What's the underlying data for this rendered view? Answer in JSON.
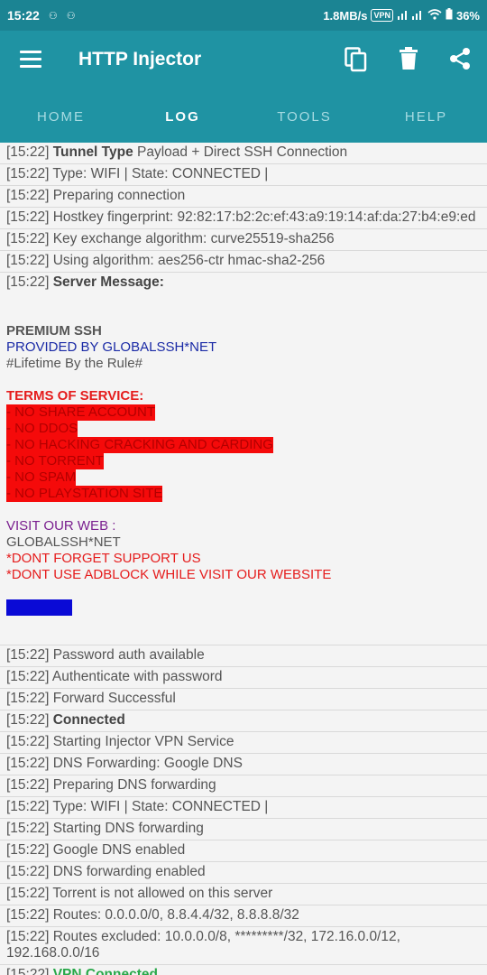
{
  "status_bar": {
    "time": "15:22",
    "speed": "1.8MB/s",
    "vpn_badge": "VPN",
    "battery": "36%"
  },
  "app_bar": {
    "title": "HTTP Injector",
    "icons": [
      "menu-icon",
      "copy-icon",
      "delete-icon",
      "share-icon"
    ]
  },
  "tabs": [
    {
      "label": "HOME",
      "active": false
    },
    {
      "label": "LOG",
      "active": true
    },
    {
      "label": "TOOLS",
      "active": false
    },
    {
      "label": "HELP",
      "active": false
    }
  ],
  "log_top": [
    {
      "ts": "[15:22]",
      "bold": "Tunnel Type",
      "text": " Payload + Direct SSH Connection"
    },
    {
      "ts": "[15:22]",
      "bold": "",
      "text": " Type: WIFI | State: CONNECTED |"
    },
    {
      "ts": "[15:22]",
      "bold": "",
      "text": " Preparing connection"
    },
    {
      "ts": "[15:22]",
      "bold": "",
      "text": " Hostkey fingerprint: 92:82:17:b2:2c:ef:43:a9:19:14:af:da:27:b4:e9:ed"
    },
    {
      "ts": "[15:22]",
      "bold": "",
      "text": " Key exchange algorithm: curve25519-sha256"
    },
    {
      "ts": "[15:22]",
      "bold": "",
      "text": " Using algorithm: aes256-ctr hmac-sha2-256"
    }
  ],
  "server_message": {
    "ts": "[15:22]",
    "label": "Server Message:",
    "title": "PREMIUM SSH",
    "provided": "PROVIDED BY GLOBALSSH*NET",
    "tagline": "#Lifetime By the Rule#",
    "tos_title": "TERMS OF SERVICE:",
    "tos_items": [
      "- NO SHARE ACCOUNT",
      "- NO DDOS",
      "- NO HACKING CRACKING AND CARDING",
      "- NO TORRENT",
      "- NO SPAM",
      "- NO PLAYSTATION SITE"
    ],
    "visit": "VISIT OUR WEB :",
    "site": "GLOBALSSH*NET",
    "support": "*DONT FORGET SUPPORT US",
    "adblock": "*DONT USE ADBLOCK WHILE VISIT OUR WEBSITE"
  },
  "log_bottom": [
    {
      "ts": "[15:22]",
      "text": " Password auth available",
      "style": ""
    },
    {
      "ts": "[15:22]",
      "text": " Authenticate with password",
      "style": ""
    },
    {
      "ts": "[15:22]",
      "text": " Forward Successful",
      "style": ""
    },
    {
      "ts": "[15:22]",
      "text": " Connected",
      "style": "bold"
    },
    {
      "ts": "[15:22]",
      "text": " Starting Injector VPN Service",
      "style": ""
    },
    {
      "ts": "[15:22]",
      "text": " DNS Forwarding: Google DNS",
      "style": ""
    },
    {
      "ts": "[15:22]",
      "text": " Preparing DNS forwarding",
      "style": ""
    },
    {
      "ts": "[15:22]",
      "text": " Type: WIFI | State: CONNECTED |",
      "style": ""
    },
    {
      "ts": "[15:22]",
      "text": " Starting DNS forwarding",
      "style": ""
    },
    {
      "ts": "[15:22]",
      "text": " Google DNS enabled",
      "style": ""
    },
    {
      "ts": "[15:22]",
      "text": " DNS forwarding enabled",
      "style": ""
    },
    {
      "ts": "[15:22]",
      "text": " Torrent is not allowed on this server",
      "style": ""
    },
    {
      "ts": "[15:22]",
      "text": " Routes: 0.0.0.0/0, 8.8.4.4/32, 8.8.8.8/32",
      "style": ""
    },
    {
      "ts": "[15:22]",
      "text": " Routes excluded: 10.0.0.0/8, *********/32, 172.16.0.0/12, 192.168.0.0/16",
      "style": "wrap"
    },
    {
      "ts": "[15:22]",
      "text": " VPN Connected",
      "style": "green"
    }
  ],
  "colors": {
    "status_bar": "#1b8493",
    "app_bar": "#1f93a3",
    "tab_inactive": "#a8dbe2",
    "highlight_red": "#f50a0a",
    "vpn_connected": "#2aa84a"
  }
}
